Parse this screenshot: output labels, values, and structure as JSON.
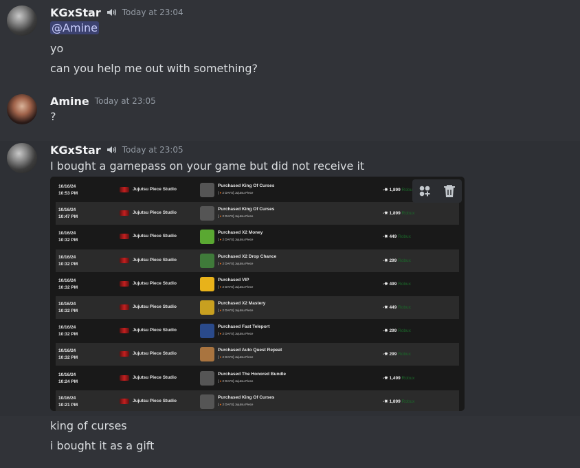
{
  "messages": [
    {
      "author": "KGxStar",
      "timestamp": "Today at 23:04",
      "mention": "@Amine",
      "lines": [
        "yo",
        "can you help me out with something?"
      ]
    },
    {
      "author": "Amine",
      "timestamp": "Today at 23:05",
      "lines": [
        "?"
      ]
    },
    {
      "author": "KGxStar",
      "timestamp": "Today at 23:05",
      "lines_before": [
        "I bought a gamepass on your game but did not receive it"
      ],
      "lines_after": [
        "king of curses",
        "i bought it as a gift"
      ]
    }
  ],
  "transactions": [
    {
      "date": "10/16/24",
      "time": "10:53 PM",
      "studio": "Jujutsu Piece Studio",
      "item": "Purchased King Of Curses",
      "sub_tag": "[ ",
      "sub": "2 DAYS] Jujutsu Piece",
      "price": "1,899",
      "thumb": "gray"
    },
    {
      "date": "10/16/24",
      "time": "10:47 PM",
      "studio": "Jujutsu Piece Studio",
      "item": "Purchased King Of Curses",
      "sub_tag": "[ ",
      "sub": "2 DAYS] Jujutsu Piece",
      "price": "1,899",
      "thumb": "gray"
    },
    {
      "date": "10/16/24",
      "time": "10:32 PM",
      "studio": "Jujutsu Piece Studio",
      "item": "Purchased X2 Money",
      "sub_tag": "[ ",
      "sub": "2 DAYS] Jujutsu Piece",
      "price": "449",
      "thumb": "money"
    },
    {
      "date": "10/16/24",
      "time": "10:32 PM",
      "studio": "Jujutsu Piece Studio",
      "item": "Purchased X2 Drop Chance",
      "sub_tag": "[ ",
      "sub": "2 DAYS] Jujutsu Piece",
      "price": "299",
      "thumb": "drop"
    },
    {
      "date": "10/16/24",
      "time": "10:32 PM",
      "studio": "Jujutsu Piece Studio",
      "item": "Purchased VIP",
      "sub_tag": "[ ",
      "sub": "2 DAYS] Jujutsu Piece",
      "price": "499",
      "thumb": "vip"
    },
    {
      "date": "10/16/24",
      "time": "10:32 PM",
      "studio": "Jujutsu Piece Studio",
      "item": "Purchased X2 Mastery",
      "sub_tag": "[ ",
      "sub": "2 DAYS] Jujutsu Piece",
      "price": "449",
      "thumb": "mastery"
    },
    {
      "date": "10/16/24",
      "time": "10:32 PM",
      "studio": "Jujutsu Piece Studio",
      "item": "Purchased Fast Teleport",
      "sub_tag": "[ ",
      "sub": "2 DAYS] Jujutsu Piece",
      "price": "299",
      "thumb": "teleport"
    },
    {
      "date": "10/16/24",
      "time": "10:32 PM",
      "studio": "Jujutsu Piece Studio",
      "item": "Purchased Auto Quest Repeat",
      "sub_tag": "[ ",
      "sub": "2 DAYS] Jujutsu Piece",
      "price": "299",
      "thumb": "quest"
    },
    {
      "date": "10/16/24",
      "time": "10:24 PM",
      "studio": "Jujutsu Piece Studio",
      "item": "Purchased The Honored Bundle",
      "sub_tag": "[ ",
      "sub": "2 DAYS] Jujutsu Piece",
      "price": "1,499",
      "thumb": "gray"
    },
    {
      "date": "10/16/24",
      "time": "10:21 PM",
      "studio": "Jujutsu Piece Studio",
      "item": "Purchased King Of Curses",
      "sub_tag": "[ ",
      "sub": "2 DAYS] Jujutsu Piece",
      "price": "1,899",
      "thumb": "gray"
    }
  ],
  "price_suffix": "Robux",
  "thumb_colors": {
    "gray": "#555555",
    "money": "#5aa832",
    "drop": "#3f7a3a",
    "vip": "#e8b21a",
    "mastery": "#c8a020",
    "teleport": "#2a4a8a",
    "quest": "#a9743f"
  },
  "icons": {
    "speaker": "speaker-icon",
    "add_reaction": "add-reaction-icon",
    "delete": "trash-icon",
    "studio": "studio-logo-icon",
    "robux": "robux-icon"
  }
}
